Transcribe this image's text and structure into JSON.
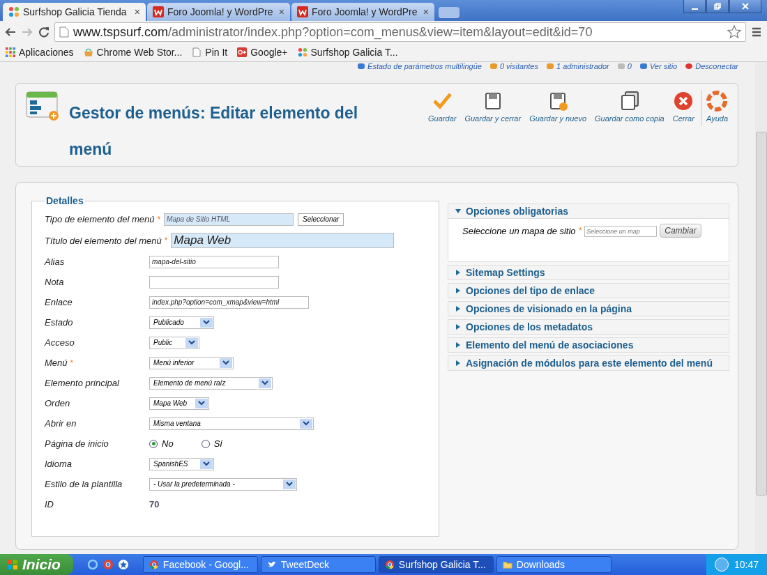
{
  "browser": {
    "tabs": [
      {
        "title": "Surfshop Galicia Tienda",
        "close": "×",
        "selected": true
      },
      {
        "title": "Foro Joomla! y WordPre",
        "close": "×",
        "selected": false
      },
      {
        "title": "Foro Joomla! y WordPre",
        "close": "×",
        "selected": false
      }
    ],
    "url_host": "www.tspsurf.com",
    "url_path": "/administrator/index.php?option=com_menus&view=item&layout=edit&id=70",
    "bookmarks": [
      "Aplicaciones",
      "Chrome Web Stor...",
      "Pin It",
      "Google+",
      "Surfshop Galicia T..."
    ]
  },
  "status_links": [
    "Estado de parámetros multilingüe",
    "0 visitantes",
    "1 administrador",
    "0",
    "Ver sitio",
    "Desconectar"
  ],
  "header": {
    "title": "Gestor de menús: Editar elemento del menú",
    "toolbar": [
      "Guardar",
      "Guardar y cerrar",
      "Guardar y nuevo",
      "Guardar como copia",
      "Cerrar",
      "Ayuda"
    ]
  },
  "details": {
    "legend": "Detalles",
    "fields": [
      {
        "kind": "picker",
        "label": "Tipo de elemento del menú",
        "required_mark": "*",
        "value": "Mapa de Sitio HTML",
        "button": "Seleccionar"
      },
      {
        "kind": "title",
        "label": "Título del elemento del menú",
        "required_mark": "*",
        "value": "Mapa Web"
      },
      {
        "kind": "text",
        "label": "Alias",
        "value": "mapa-del-sitio"
      },
      {
        "kind": "text",
        "label": "Nota"
      },
      {
        "kind": "text",
        "label": "Enlace",
        "value": "index.php?option=com_xmap&view=html"
      },
      {
        "kind": "select",
        "label": "Estado",
        "value": "Publicado"
      },
      {
        "kind": "select",
        "label": "Acceso",
        "value": "Public"
      },
      {
        "kind": "select",
        "label": "Menú",
        "required_mark": "*",
        "value": "Menú inferior"
      },
      {
        "kind": "select",
        "label": "Elemento principal",
        "value": "Elemento de menú raíz"
      },
      {
        "kind": "select",
        "label": "Orden",
        "value": "Mapa Web"
      },
      {
        "kind": "select",
        "label": "Abrir en",
        "value": "Misma ventana"
      },
      {
        "kind": "radio",
        "label": "Página de inicio",
        "options": [
          {
            "label": "No",
            "selected": true
          },
          {
            "label": "Sí",
            "selected": false
          }
        ]
      },
      {
        "kind": "select",
        "label": "Idioma",
        "value": "SpanishES"
      },
      {
        "kind": "select",
        "label": "Estilo de la plantilla",
        "value": "- Usar la predeterminada -"
      },
      {
        "kind": "static",
        "label": "ID",
        "value": "70"
      }
    ]
  },
  "panels": [
    {
      "title": "Opciones obligatorias",
      "expanded": true,
      "field_label": "Seleccione un mapa de sitio",
      "field_mark": "*",
      "field_placeholder": "Seleccione un map",
      "button": "Cambiar"
    },
    {
      "title": "Sitemap Settings",
      "expanded": false
    },
    {
      "title": "Opciones del tipo de enlace",
      "expanded": false
    },
    {
      "title": "Opciones de visionado en la página",
      "expanded": false
    },
    {
      "title": "Opciones de los metadatos",
      "expanded": false
    },
    {
      "title": "Elemento del menú de asociaciones",
      "expanded": false
    },
    {
      "title": "Asignación de módulos para este elemento del menú",
      "expanded": false
    }
  ],
  "taskbar": {
    "start": "Inicio",
    "items": [
      {
        "label": "Facebook - Googl...",
        "selected": false
      },
      {
        "label": "TweetDeck",
        "selected": false
      },
      {
        "label": "Surfshop Galicia T...",
        "selected": true
      },
      {
        "label": "Downloads",
        "selected": false
      }
    ],
    "clock": "10:47"
  }
}
